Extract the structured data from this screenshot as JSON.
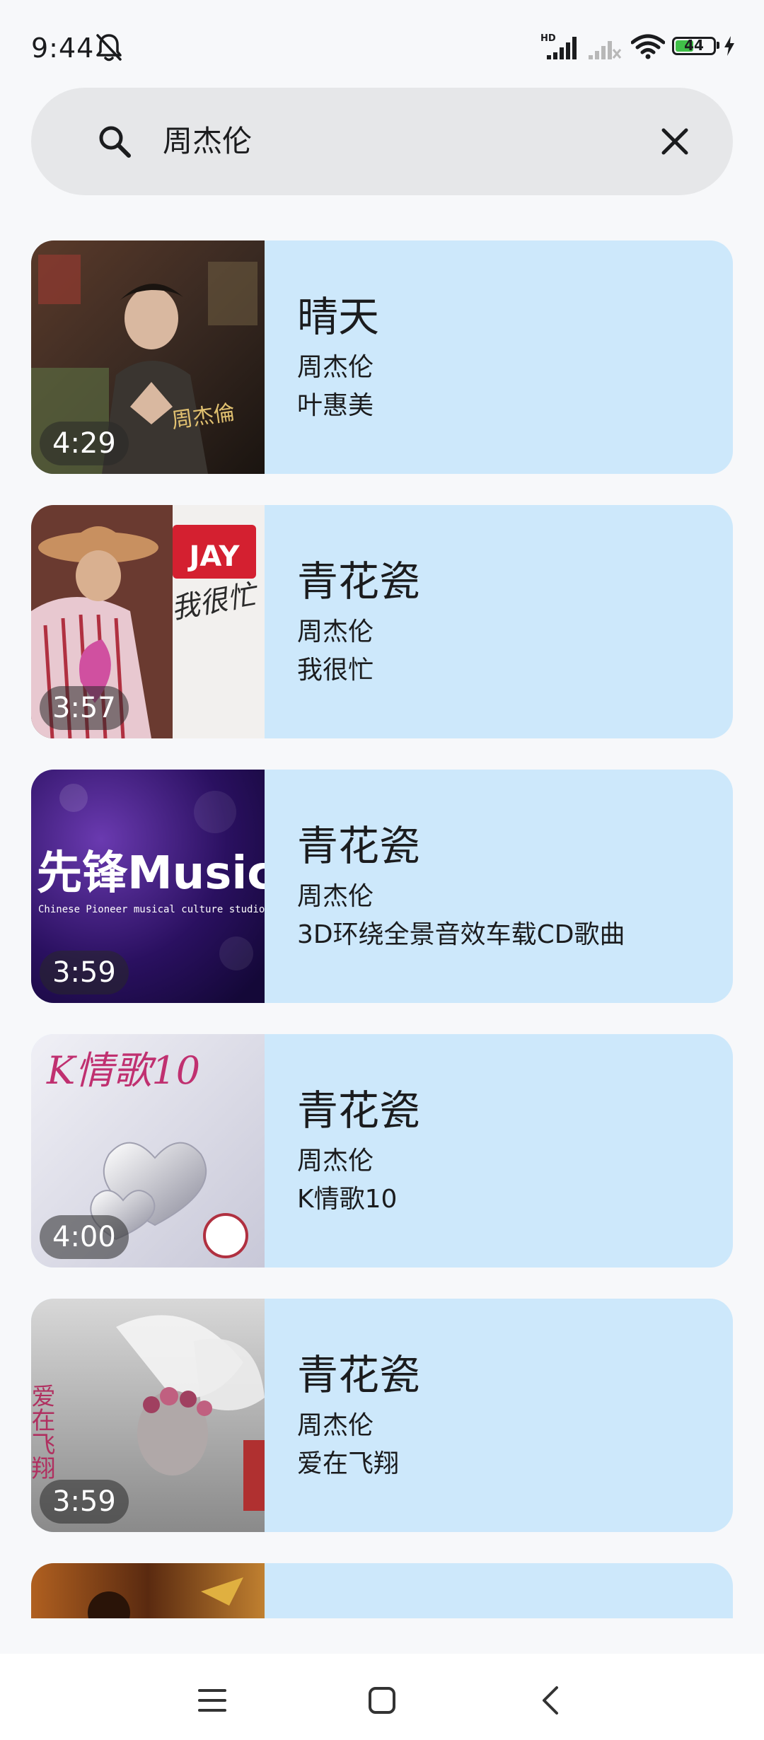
{
  "status_bar": {
    "time": "9:44",
    "network_label": "HD",
    "battery_level": "44",
    "battery_fraction": 0.44,
    "icons": [
      "bell-off-icon",
      "signal-hd-icon",
      "signal-icon",
      "wifi-icon",
      "battery-icon",
      "charging-icon"
    ]
  },
  "search": {
    "query": "周杰伦",
    "icon": "search-icon",
    "clear_icon": "close-icon"
  },
  "results": [
    {
      "title": "晴天",
      "artist": "周杰伦",
      "album": "叶惠美",
      "duration": "4:29"
    },
    {
      "title": "青花瓷",
      "artist": "周杰伦",
      "album": "我很忙",
      "duration": "3:57"
    },
    {
      "title": "青花瓷",
      "artist": "周杰伦",
      "album": "3D环绕全景音效车载CD歌曲",
      "duration": "3:59",
      "cover_text": "先锋Music",
      "cover_subtext": "Chinese Pioneer musical culture studio"
    },
    {
      "title": "青花瓷",
      "artist": "周杰伦",
      "album": "K情歌10",
      "duration": "4:00",
      "cover_text": "K情歌10"
    },
    {
      "title": "青花瓷",
      "artist": "周杰伦",
      "album": "爱在飞翔",
      "duration": "3:59",
      "cover_text": "爱在飞翔"
    }
  ],
  "nav": {
    "icons": [
      "menu-icon",
      "home-icon",
      "back-icon"
    ]
  },
  "colors": {
    "card": "#cde8fb",
    "search_bg": "#e6e7e9",
    "background": "#f7f8fa",
    "battery": "#40c048"
  }
}
